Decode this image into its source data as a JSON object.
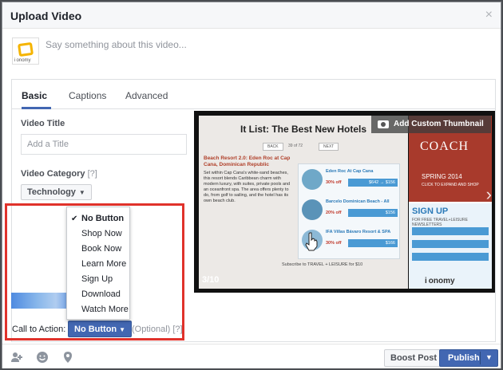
{
  "dialog": {
    "title": "Upload Video",
    "close_glyph": "×"
  },
  "composer": {
    "placeholder": "Say something about this video...",
    "avatar_text": "i onomy"
  },
  "tabs": [
    {
      "label": "Basic",
      "active": true
    },
    {
      "label": "Captions",
      "active": false
    },
    {
      "label": "Advanced",
      "active": false
    }
  ],
  "form": {
    "video_title_label": "Video Title",
    "title_placeholder": "Add a Title",
    "category_label": "Video Category",
    "category_hint": "[?]",
    "category_value": "Technology"
  },
  "thumbnail": {
    "add_custom_label": "Add Custom Thumbnail",
    "counter": "3/10",
    "article_title": "It List: The Best New Hotels",
    "nav_back": "BACK",
    "nav_next": "NEXT",
    "page": "39 of 72",
    "article_head": "Beach Resort 2.0: Eden Roc at Cap Cana, Dominican Republic",
    "article_body": "Set within Cap Cana's white-sand beaches, this resort blends Caribbean charm with modern luxury, with suites, private pools and an oceanfront spa. The area offers plenty to do, from golf to sailing, and the hotel has its own beach club.",
    "deals": [
      {
        "name": "Eden Roc At Cap Cana",
        "pct": "30% off",
        "price": "$642 → $156"
      },
      {
        "name": "Barcelo Dominican Beach - All",
        "pct": "20% off",
        "price": "$156"
      },
      {
        "name": "IFA Villas Bávaro Resort & SPA",
        "pct": "30% off",
        "price": "$166"
      }
    ],
    "subscribe": "Subscribe to TRAVEL + LEISURE for $10",
    "ad_brand": "COACH",
    "ad_season": "SPRING 2014",
    "ad_shop": "CLICK TO EXPAND AND SHOP",
    "signup": "SIGN UP",
    "signup_sub": "FOR FREE TRAVEL+LEISURE NEWSLETTERS",
    "ad_logo": "i onomy"
  },
  "cta": {
    "label": "Call to Action:",
    "value": "No Button",
    "optional": "(Optional)",
    "hint": "[?]",
    "menu": [
      "No Button",
      "Shop Now",
      "Book Now",
      "Learn More",
      "Sign Up",
      "Download",
      "Watch More"
    ],
    "selected_index": 0
  },
  "footer": {
    "boost_label": "Boost Post",
    "publish_label": "Publish"
  },
  "colors": {
    "accent": "#4267b2",
    "highlight_border": "#e0322b"
  }
}
